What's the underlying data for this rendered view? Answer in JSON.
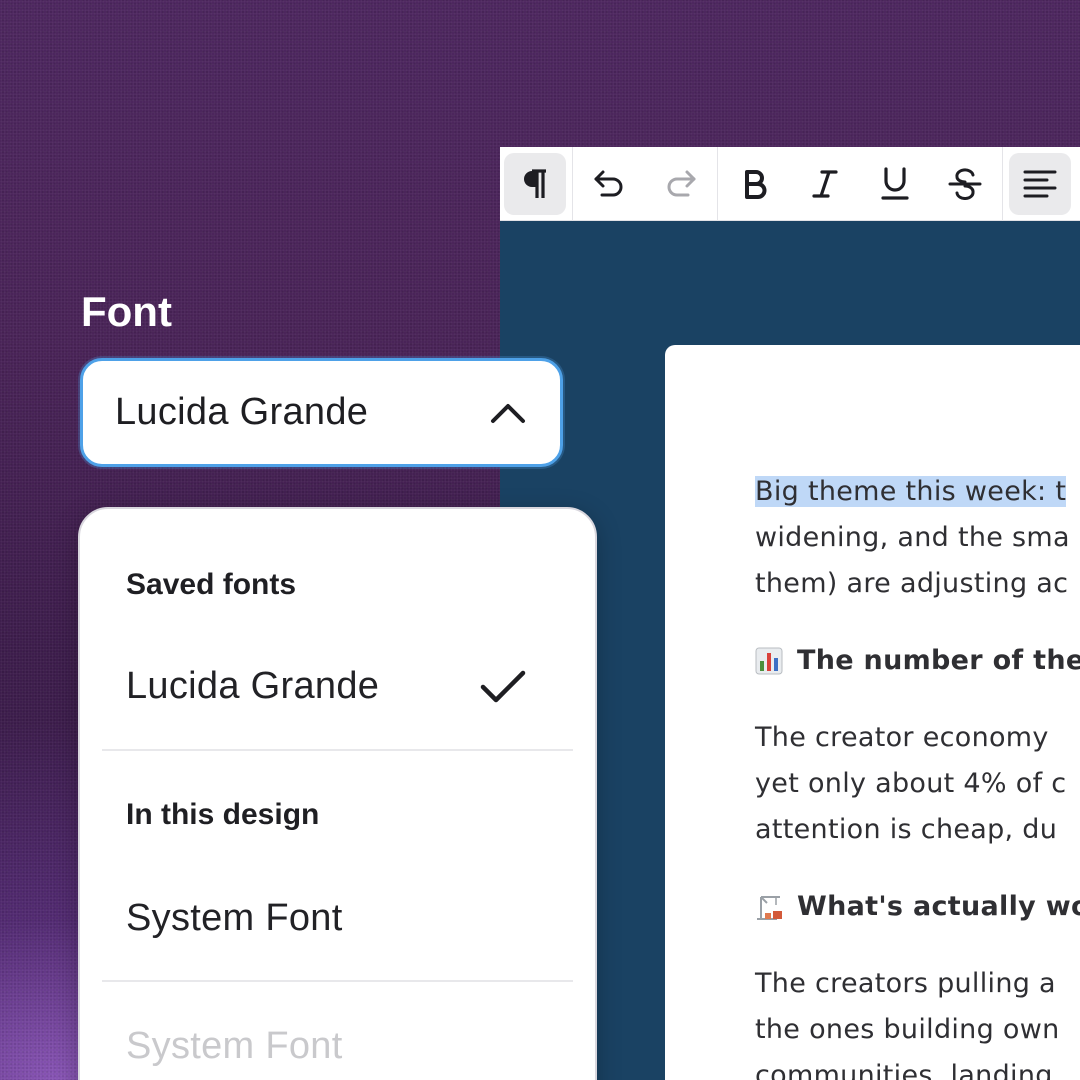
{
  "font_panel": {
    "label": "Font",
    "selected_value": "Lucida Grande",
    "sections": [
      {
        "title": "Saved fonts",
        "options": [
          {
            "name": "Lucida Grande",
            "selected": true
          }
        ]
      },
      {
        "title": "In this design",
        "options": [
          {
            "name": "System Font",
            "selected": false
          }
        ]
      }
    ],
    "partial_option": "System Font"
  },
  "toolbar": {
    "buttons": [
      {
        "icon": "pilcrow-icon",
        "active": true
      },
      {
        "icon": "undo-icon",
        "active": false
      },
      {
        "icon": "redo-icon",
        "disabled": true
      },
      {
        "icon": "bold-icon",
        "active": false
      },
      {
        "icon": "italic-icon",
        "active": false
      },
      {
        "icon": "underline-icon",
        "active": false
      },
      {
        "icon": "strikethrough-icon",
        "active": false
      },
      {
        "icon": "align-left-icon",
        "active": true
      }
    ]
  },
  "document": {
    "p1": {
      "highlighted": "Big theme this week: t",
      "line2": "widening, and the sma",
      "line3": "them) are adjusting ac"
    },
    "h1": {
      "emoji": "chart-emoji",
      "text": "The number of the"
    },
    "p2": {
      "line1": "The creator economy",
      "line2": "yet only about 4% of c",
      "line3": "attention is cheap, du"
    },
    "h2": {
      "emoji": "construction-emoji",
      "text": "What's actually wo"
    },
    "p3": {
      "line1": "The creators pulling a",
      "line2": "the ones building own",
      "line3": "communities, landing"
    }
  },
  "colors": {
    "background": "#4a2458",
    "editor_bg": "#1a4263",
    "select_border": "#4ea1e8",
    "highlight": "#bfd8f7"
  }
}
